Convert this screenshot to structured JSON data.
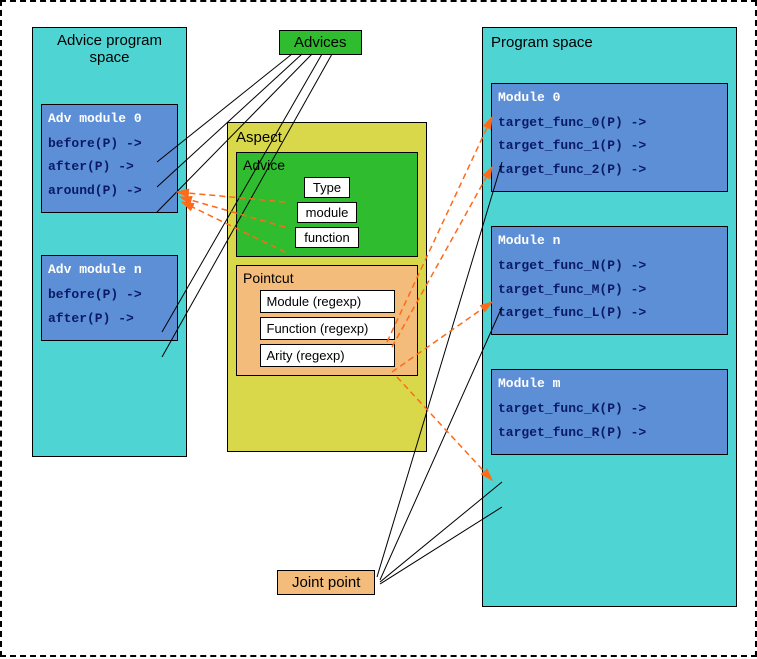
{
  "labels": {
    "advices": "Advices",
    "joint_point": "Joint point"
  },
  "advice_program_space": {
    "title": "Advice program space",
    "modules": [
      {
        "title": "Adv module 0",
        "lines": [
          "before(P) ->",
          "after(P) ->",
          "around(P) ->"
        ]
      },
      {
        "title": "Adv module n",
        "lines": [
          "before(P) ->",
          "after(P) ->"
        ]
      }
    ]
  },
  "aspect": {
    "title": "Aspect",
    "advice": {
      "title": "Advice",
      "items": [
        "Type",
        "module",
        "function"
      ]
    },
    "pointcut": {
      "title": "Pointcut",
      "items": [
        "Module (regexp)",
        "Function (regexp)",
        "Arity (regexp)"
      ]
    }
  },
  "program_space": {
    "title": "Program space",
    "modules": [
      {
        "title": "Module 0",
        "lines": [
          "target_func_0(P) ->",
          "target_func_1(P) ->",
          "target_func_2(P) ->"
        ]
      },
      {
        "title": "Module n",
        "lines": [
          "target_func_N(P) ->",
          "target_func_M(P) ->",
          "target_func_L(P) ->"
        ]
      },
      {
        "title": "Module m",
        "lines": [
          "target_func_K(P) ->",
          "target_func_R(P) ->"
        ]
      }
    ]
  }
}
